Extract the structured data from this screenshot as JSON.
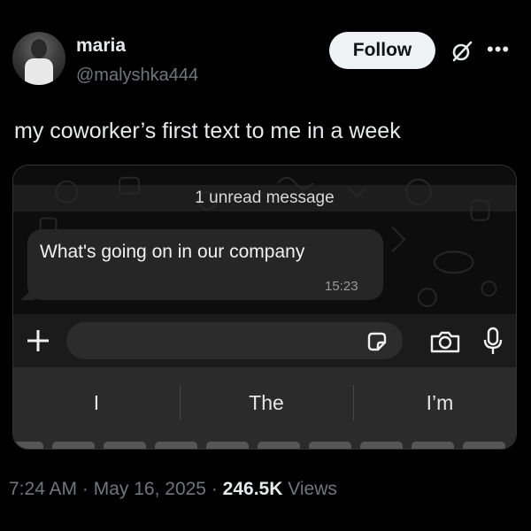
{
  "author": {
    "name": "maria",
    "handle": "@malyshka444",
    "follow_label": "Follow",
    "avatar_icon": "profile-photo"
  },
  "tweet": {
    "text": "my coworker’s first text to me in a week"
  },
  "chat": {
    "unread_banner": "1 unread message",
    "message_text": "What's going on in our company",
    "message_time": "15:23",
    "input_placeholder": "",
    "keyboard_suggestions": [
      "I",
      "The",
      "I’m"
    ]
  },
  "meta": {
    "time": "7:24 AM",
    "separator": " · ",
    "date": "May 16, 2025",
    "views_count": "246.5K",
    "views_label": " Views"
  },
  "colors": {
    "background": "#000000",
    "text_primary": "#e7e9ea",
    "text_secondary": "#71767b",
    "follow_button_bg": "#eff3f4",
    "chat_bubble": "#262626",
    "keyboard": "#2b2b2b"
  }
}
